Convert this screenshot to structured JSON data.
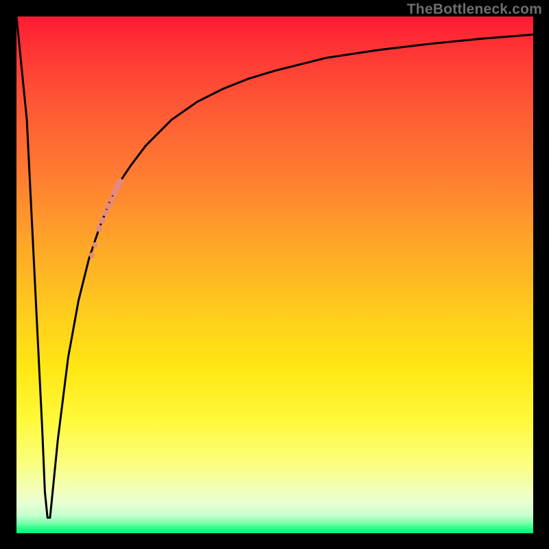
{
  "watermark": {
    "text": "TheBottleneck.com"
  },
  "chart_data": {
    "type": "line",
    "title": "",
    "xlabel": "",
    "ylabel": "",
    "xlim": [
      0,
      100
    ],
    "ylim": [
      0,
      100
    ],
    "grid": false,
    "series": [
      {
        "name": "bottleneck-curve",
        "x": [
          0,
          2,
          3,
          4,
          5,
          5.5,
          6,
          6.5,
          7,
          8,
          10,
          12,
          14,
          16,
          18,
          20,
          22,
          25,
          30,
          35,
          40,
          45,
          50,
          60,
          70,
          80,
          90,
          100
        ],
        "values": [
          100,
          80,
          60,
          40,
          20,
          8,
          3,
          3,
          8,
          18,
          34,
          45,
          53,
          59,
          64,
          68,
          71,
          75,
          80,
          83.5,
          86,
          88,
          89.5,
          92,
          93.5,
          94.7,
          95.7,
          96.5
        ]
      }
    ],
    "highlight": {
      "name": "highlight-dots",
      "color": "#e48a82",
      "points": [
        {
          "x": 16.0,
          "y": 59.0,
          "r": 5
        },
        {
          "x": 16.6,
          "y": 60.5,
          "r": 5
        },
        {
          "x": 17.2,
          "y": 62.0,
          "r": 5
        },
        {
          "x": 17.8,
          "y": 63.3,
          "r": 5
        },
        {
          "x": 18.4,
          "y": 64.6,
          "r": 5
        },
        {
          "x": 19.0,
          "y": 65.9,
          "r": 5
        },
        {
          "x": 19.5,
          "y": 67.0,
          "r": 5
        },
        {
          "x": 20.0,
          "y": 68.0,
          "r": 5
        },
        {
          "x": 15.2,
          "y": 55.8,
          "r": 4
        },
        {
          "x": 14.6,
          "y": 53.8,
          "r": 4
        }
      ]
    }
  }
}
